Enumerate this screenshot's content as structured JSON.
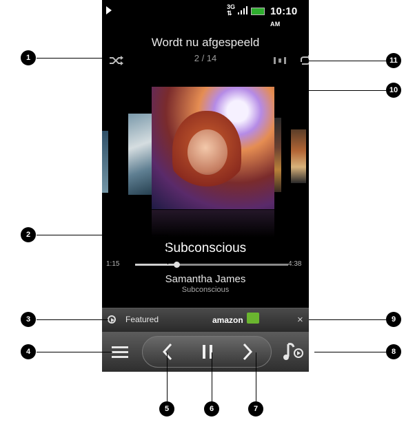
{
  "status_bar": {
    "network": [
      "3G",
      "⇅"
    ],
    "time": "10:10",
    "ampm": "AM",
    "battery_color": "#2fae2f",
    "icons": [
      "play-indicator-icon",
      "signal-icon",
      "battery-icon"
    ]
  },
  "now_playing": {
    "title": "Wordt nu afgespeeld",
    "counter": "2 / 14"
  },
  "track": {
    "title": "Subconscious",
    "artist": "Samantha James",
    "album": "Subconscious",
    "elapsed": "1:15",
    "total": "4:38",
    "progress_fraction": 0.27
  },
  "featured_bar": {
    "label": "Featured",
    "store": "amazon",
    "close": "×"
  },
  "controls": {
    "icons": [
      "menu-icon",
      "previous-icon",
      "pause-icon",
      "next-icon",
      "library-icon"
    ]
  },
  "callouts": [
    "1",
    "2",
    "3",
    "4",
    "5",
    "6",
    "7",
    "8",
    "9",
    "10",
    "11"
  ]
}
